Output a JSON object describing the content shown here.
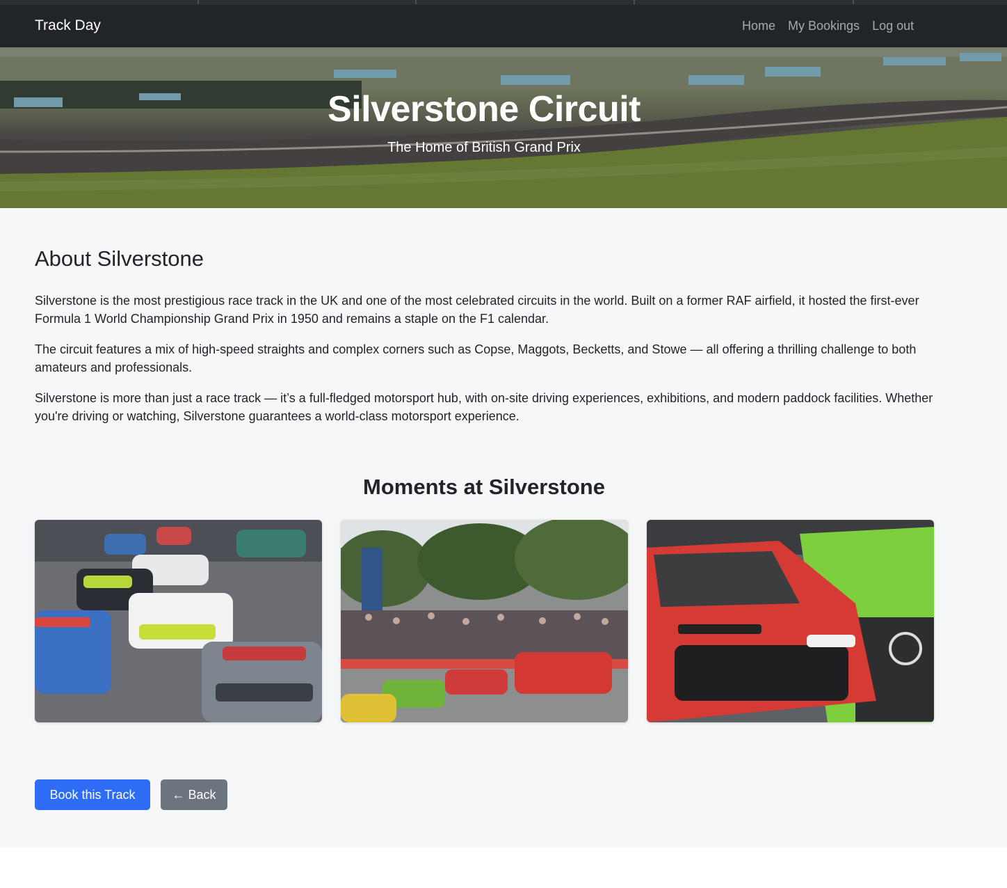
{
  "navbar": {
    "brand": "Track Day",
    "links": [
      "Home",
      "My Bookings",
      "Log out"
    ]
  },
  "hero": {
    "title": "Silverstone Circuit",
    "subtitle": "The Home of British Grand Prix"
  },
  "about": {
    "heading": "About Silverstone",
    "paragraphs": [
      "Silverstone is the most prestigious race track in the UK and one of the most celebrated circuits in the world. Built on a former RAF airfield, it hosted the first-ever Formula 1 World Championship Grand Prix in 1950 and remains a staple on the F1 calendar.",
      "The circuit features a mix of high-speed straights and complex corners such as Copse, Maggots, Becketts, and Stowe — all offering a thrilling challenge to both amateurs and professionals.",
      "Silverstone is more than just a race track — it’s a full-fledged motorsport hub, with on-site driving experiences, exhibitions, and modern paddock facilities. Whether you're driving or watching, Silverstone guarantees a world-class motorsport experience."
    ]
  },
  "gallery": {
    "heading": "Moments at Silverstone",
    "photos": [
      "race-cars-on-track",
      "crowd-and-supercars",
      "red-audi-gt-car"
    ]
  },
  "actions": {
    "book_label": "Book this Track",
    "back_label": "Back",
    "back_icon": "arrow-left-icon"
  },
  "colors": {
    "navbar": "#212529",
    "primary": "#2f6cf5",
    "secondary": "#6c757d",
    "page_bg": "#f6f7f9"
  }
}
